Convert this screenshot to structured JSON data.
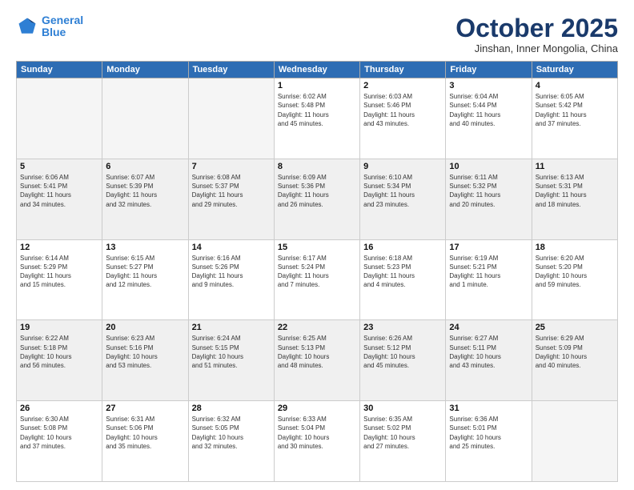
{
  "header": {
    "logo_line1": "General",
    "logo_line2": "Blue",
    "month": "October 2025",
    "location": "Jinshan, Inner Mongolia, China"
  },
  "weekdays": [
    "Sunday",
    "Monday",
    "Tuesday",
    "Wednesday",
    "Thursday",
    "Friday",
    "Saturday"
  ],
  "weeks": [
    [
      {
        "day": "",
        "info": ""
      },
      {
        "day": "",
        "info": ""
      },
      {
        "day": "",
        "info": ""
      },
      {
        "day": "1",
        "info": "Sunrise: 6:02 AM\nSunset: 5:48 PM\nDaylight: 11 hours\nand 45 minutes."
      },
      {
        "day": "2",
        "info": "Sunrise: 6:03 AM\nSunset: 5:46 PM\nDaylight: 11 hours\nand 43 minutes."
      },
      {
        "day": "3",
        "info": "Sunrise: 6:04 AM\nSunset: 5:44 PM\nDaylight: 11 hours\nand 40 minutes."
      },
      {
        "day": "4",
        "info": "Sunrise: 6:05 AM\nSunset: 5:42 PM\nDaylight: 11 hours\nand 37 minutes."
      }
    ],
    [
      {
        "day": "5",
        "info": "Sunrise: 6:06 AM\nSunset: 5:41 PM\nDaylight: 11 hours\nand 34 minutes."
      },
      {
        "day": "6",
        "info": "Sunrise: 6:07 AM\nSunset: 5:39 PM\nDaylight: 11 hours\nand 32 minutes."
      },
      {
        "day": "7",
        "info": "Sunrise: 6:08 AM\nSunset: 5:37 PM\nDaylight: 11 hours\nand 29 minutes."
      },
      {
        "day": "8",
        "info": "Sunrise: 6:09 AM\nSunset: 5:36 PM\nDaylight: 11 hours\nand 26 minutes."
      },
      {
        "day": "9",
        "info": "Sunrise: 6:10 AM\nSunset: 5:34 PM\nDaylight: 11 hours\nand 23 minutes."
      },
      {
        "day": "10",
        "info": "Sunrise: 6:11 AM\nSunset: 5:32 PM\nDaylight: 11 hours\nand 20 minutes."
      },
      {
        "day": "11",
        "info": "Sunrise: 6:13 AM\nSunset: 5:31 PM\nDaylight: 11 hours\nand 18 minutes."
      }
    ],
    [
      {
        "day": "12",
        "info": "Sunrise: 6:14 AM\nSunset: 5:29 PM\nDaylight: 11 hours\nand 15 minutes."
      },
      {
        "day": "13",
        "info": "Sunrise: 6:15 AM\nSunset: 5:27 PM\nDaylight: 11 hours\nand 12 minutes."
      },
      {
        "day": "14",
        "info": "Sunrise: 6:16 AM\nSunset: 5:26 PM\nDaylight: 11 hours\nand 9 minutes."
      },
      {
        "day": "15",
        "info": "Sunrise: 6:17 AM\nSunset: 5:24 PM\nDaylight: 11 hours\nand 7 minutes."
      },
      {
        "day": "16",
        "info": "Sunrise: 6:18 AM\nSunset: 5:23 PM\nDaylight: 11 hours\nand 4 minutes."
      },
      {
        "day": "17",
        "info": "Sunrise: 6:19 AM\nSunset: 5:21 PM\nDaylight: 11 hours\nand 1 minute."
      },
      {
        "day": "18",
        "info": "Sunrise: 6:20 AM\nSunset: 5:20 PM\nDaylight: 10 hours\nand 59 minutes."
      }
    ],
    [
      {
        "day": "19",
        "info": "Sunrise: 6:22 AM\nSunset: 5:18 PM\nDaylight: 10 hours\nand 56 minutes."
      },
      {
        "day": "20",
        "info": "Sunrise: 6:23 AM\nSunset: 5:16 PM\nDaylight: 10 hours\nand 53 minutes."
      },
      {
        "day": "21",
        "info": "Sunrise: 6:24 AM\nSunset: 5:15 PM\nDaylight: 10 hours\nand 51 minutes."
      },
      {
        "day": "22",
        "info": "Sunrise: 6:25 AM\nSunset: 5:13 PM\nDaylight: 10 hours\nand 48 minutes."
      },
      {
        "day": "23",
        "info": "Sunrise: 6:26 AM\nSunset: 5:12 PM\nDaylight: 10 hours\nand 45 minutes."
      },
      {
        "day": "24",
        "info": "Sunrise: 6:27 AM\nSunset: 5:11 PM\nDaylight: 10 hours\nand 43 minutes."
      },
      {
        "day": "25",
        "info": "Sunrise: 6:29 AM\nSunset: 5:09 PM\nDaylight: 10 hours\nand 40 minutes."
      }
    ],
    [
      {
        "day": "26",
        "info": "Sunrise: 6:30 AM\nSunset: 5:08 PM\nDaylight: 10 hours\nand 37 minutes."
      },
      {
        "day": "27",
        "info": "Sunrise: 6:31 AM\nSunset: 5:06 PM\nDaylight: 10 hours\nand 35 minutes."
      },
      {
        "day": "28",
        "info": "Sunrise: 6:32 AM\nSunset: 5:05 PM\nDaylight: 10 hours\nand 32 minutes."
      },
      {
        "day": "29",
        "info": "Sunrise: 6:33 AM\nSunset: 5:04 PM\nDaylight: 10 hours\nand 30 minutes."
      },
      {
        "day": "30",
        "info": "Sunrise: 6:35 AM\nSunset: 5:02 PM\nDaylight: 10 hours\nand 27 minutes."
      },
      {
        "day": "31",
        "info": "Sunrise: 6:36 AM\nSunset: 5:01 PM\nDaylight: 10 hours\nand 25 minutes."
      },
      {
        "day": "",
        "info": ""
      }
    ]
  ]
}
